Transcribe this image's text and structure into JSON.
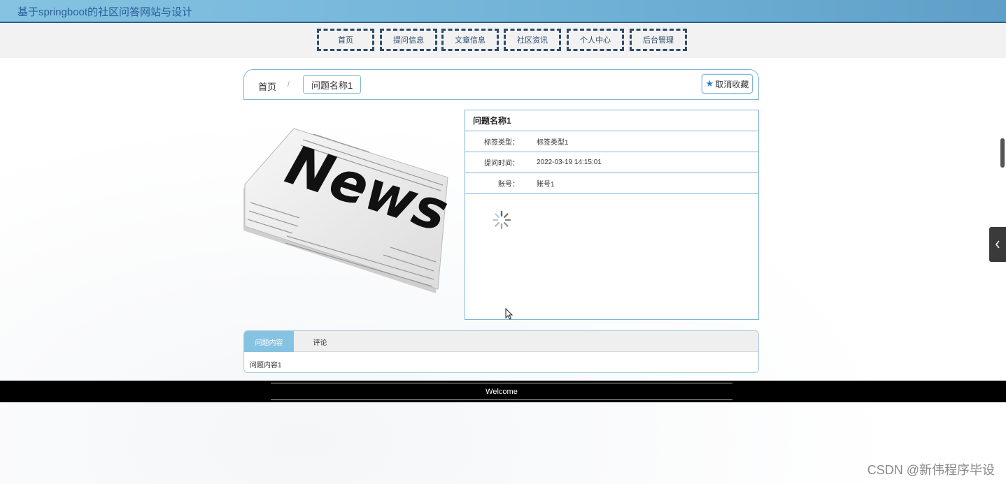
{
  "header": {
    "site_title": "基于springboot的社区问答网站与设计"
  },
  "nav": {
    "items": [
      {
        "label": "首页"
      },
      {
        "label": "提问信息"
      },
      {
        "label": "文章信息"
      },
      {
        "label": "社区资讯"
      },
      {
        "label": "个人中心"
      },
      {
        "label": "后台管理"
      }
    ]
  },
  "breadcrumb": {
    "home": "首页",
    "separator": "/",
    "current": "问题名称1"
  },
  "favorite_button": {
    "label": "取消收藏",
    "icon": "star-icon"
  },
  "image": {
    "word": "News"
  },
  "detail": {
    "title": "问题名称1",
    "rows": [
      {
        "label": "标签类型：",
        "value": "标签类型1"
      },
      {
        "label": "提问时间：",
        "value": "2022-03-19 14:15:01"
      },
      {
        "label": "账号：",
        "value": "账号1"
      }
    ]
  },
  "tabs": {
    "items": [
      {
        "label": "问题内容"
      },
      {
        "label": "评论"
      }
    ],
    "content": "问题内容1"
  },
  "footer": {
    "text": "Welcome"
  },
  "watermark": "CSDN @新伟程序毕设",
  "colors": {
    "accent": "#86c3e2",
    "nav_border": "#2c4a6e",
    "panel_border": "#7fb6d4"
  }
}
